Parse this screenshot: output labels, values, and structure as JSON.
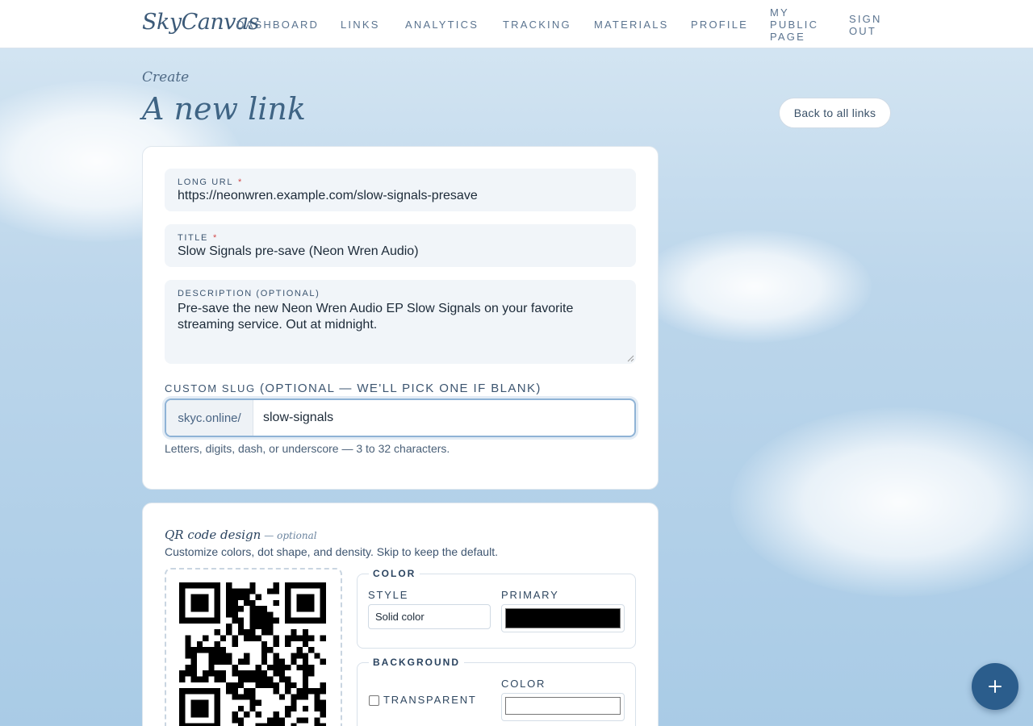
{
  "app": {
    "logo_text": "SkyCanvas"
  },
  "nav": {
    "items": [
      {
        "label": "Dashboard"
      },
      {
        "label": "Links"
      },
      {
        "label": "Analytics"
      },
      {
        "label": "Tracking"
      },
      {
        "label": "Materials"
      },
      {
        "label": "Profile"
      },
      {
        "label": "My Public Page"
      },
      {
        "label": "Sign Out"
      }
    ]
  },
  "header": {
    "eyebrow": "Create",
    "title": "A new link",
    "back_button": "Back to all links"
  },
  "form": {
    "long_url": {
      "label": "Long URL",
      "required_mark": "*",
      "value": "https://neonwren.example.com/slow-signals-presave"
    },
    "title": {
      "label": "Title",
      "required_mark": "*",
      "value": "Slow Signals pre-save (Neon Wren Audio)"
    },
    "description": {
      "label": "Description (optional)",
      "value": "Pre-save the new Neon Wren Audio EP Slow Signals on your favorite streaming service. Out at midnight."
    },
    "slug": {
      "label": "Custom slug",
      "label_hint": "(optional — we'll pick one if blank)",
      "prefix": "skyc.online/",
      "value": "slow-signals",
      "help": "Letters, digits, dash, or underscore — 3 to 32 characters."
    }
  },
  "qr": {
    "title": "QR code design",
    "optional": "— optional",
    "subtitle": "Customize colors, dot shape, and density. Skip to keep the default.",
    "color_section": {
      "legend": "Color",
      "style_label": "Style",
      "style_value": "Solid color",
      "primary_label": "Primary",
      "primary_color": "#000000"
    },
    "background_section": {
      "legend": "Background",
      "transparent_label": "Transparent",
      "transparent_checked": false,
      "color_label": "Color",
      "color_value": "#ffffff"
    }
  },
  "fab": {
    "icon": "plus-icon"
  }
}
